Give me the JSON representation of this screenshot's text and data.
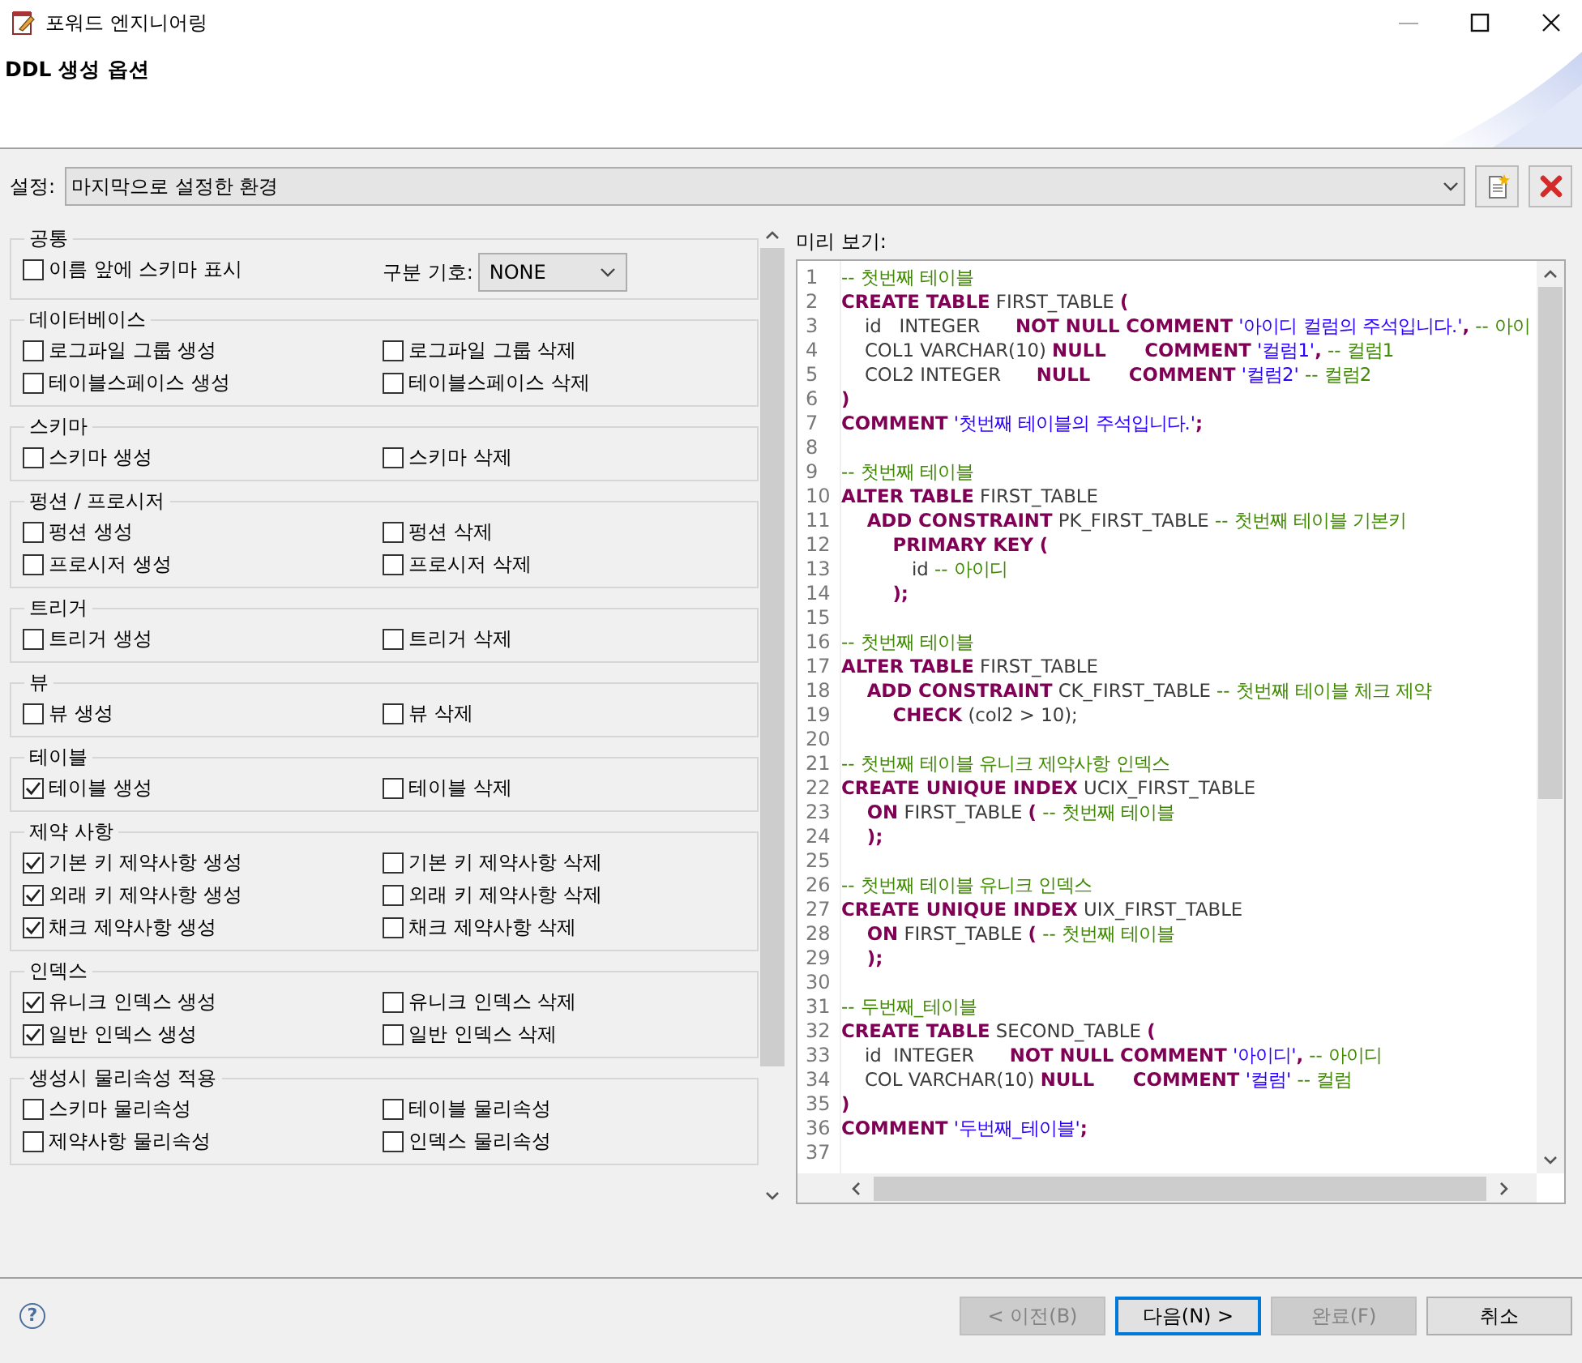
{
  "window": {
    "title": "포워드 엔지니어링"
  },
  "header": {
    "title": "DDL 생성 옵션"
  },
  "settings": {
    "label": "설정:",
    "value": "마지막으로 설정한 환경"
  },
  "options": {
    "groups": [
      {
        "title": "공통",
        "items": [
          {
            "kind": "checkbox",
            "label": "이름 앞에 스키마 표시",
            "checked": false
          },
          {
            "kind": "select",
            "label": "구분 기호:",
            "value": "NONE"
          }
        ]
      },
      {
        "title": "데이터베이스",
        "items": [
          {
            "kind": "checkbox",
            "label": "로그파일 그룹 생성",
            "checked": false
          },
          {
            "kind": "checkbox",
            "label": "로그파일 그룹 삭제",
            "checked": false
          },
          {
            "kind": "checkbox",
            "label": "테이블스페이스 생성",
            "checked": false
          },
          {
            "kind": "checkbox",
            "label": "테이블스페이스 삭제",
            "checked": false
          }
        ]
      },
      {
        "title": "스키마",
        "items": [
          {
            "kind": "checkbox",
            "label": "스키마 생성",
            "checked": false
          },
          {
            "kind": "checkbox",
            "label": "스키마 삭제",
            "checked": false
          }
        ]
      },
      {
        "title": "펑션 / 프로시저",
        "items": [
          {
            "kind": "checkbox",
            "label": "펑션 생성",
            "checked": false
          },
          {
            "kind": "checkbox",
            "label": "펑션 삭제",
            "checked": false
          },
          {
            "kind": "checkbox",
            "label": "프로시저 생성",
            "checked": false
          },
          {
            "kind": "checkbox",
            "label": "프로시저 삭제",
            "checked": false
          }
        ]
      },
      {
        "title": "트리거",
        "items": [
          {
            "kind": "checkbox",
            "label": "트리거 생성",
            "checked": false
          },
          {
            "kind": "checkbox",
            "label": "트리거 삭제",
            "checked": false
          }
        ]
      },
      {
        "title": "뷰",
        "items": [
          {
            "kind": "checkbox",
            "label": "뷰 생성",
            "checked": false
          },
          {
            "kind": "checkbox",
            "label": "뷰 삭제",
            "checked": false
          }
        ]
      },
      {
        "title": "테이블",
        "items": [
          {
            "kind": "checkbox",
            "label": "테이블 생성",
            "checked": true
          },
          {
            "kind": "checkbox",
            "label": "테이블 삭제",
            "checked": false
          }
        ]
      },
      {
        "title": "제약 사항",
        "items": [
          {
            "kind": "checkbox",
            "label": "기본 키 제약사항 생성",
            "checked": true
          },
          {
            "kind": "checkbox",
            "label": "기본 키 제약사항 삭제",
            "checked": false
          },
          {
            "kind": "checkbox",
            "label": "외래 키 제약사항 생성",
            "checked": true
          },
          {
            "kind": "checkbox",
            "label": "외래 키 제약사항 삭제",
            "checked": false
          },
          {
            "kind": "checkbox",
            "label": "채크 제약사항 생성",
            "checked": true
          },
          {
            "kind": "checkbox",
            "label": "채크 제약사항 삭제",
            "checked": false
          }
        ]
      },
      {
        "title": "인덱스",
        "items": [
          {
            "kind": "checkbox",
            "label": "유니크 인덱스 생성",
            "checked": true
          },
          {
            "kind": "checkbox",
            "label": "유니크 인덱스 삭제",
            "checked": false
          },
          {
            "kind": "checkbox",
            "label": "일반 인덱스 생성",
            "checked": true
          },
          {
            "kind": "checkbox",
            "label": "일반 인덱스 삭제",
            "checked": false
          }
        ]
      },
      {
        "title": "생성시 물리속성 적용",
        "items": [
          {
            "kind": "checkbox",
            "label": "스키마 물리속성",
            "checked": false
          },
          {
            "kind": "checkbox",
            "label": "테이블 물리속성",
            "checked": false
          },
          {
            "kind": "checkbox",
            "label": "제약사항 물리속성",
            "checked": false
          },
          {
            "kind": "checkbox",
            "label": "인덱스 물리속성",
            "checked": false
          }
        ]
      }
    ]
  },
  "preview": {
    "label": "미리 보기:",
    "lines": [
      {
        "n": "1",
        "segments": [
          {
            "kind": "comment",
            "s": "-- 첫번째 테이블"
          }
        ]
      },
      {
        "n": "2",
        "segments": [
          {
            "kind": "keyword",
            "s": "CREATE TABLE"
          },
          {
            "kind": "plain",
            "s": " FIRST_TABLE "
          },
          {
            "kind": "keyword",
            "s": "("
          }
        ]
      },
      {
        "n": "3",
        "segments": [
          {
            "kind": "plain",
            "s": "    id   INTEGER      "
          },
          {
            "kind": "keyword",
            "s": "NOT NULL COMMENT"
          },
          {
            "kind": "string",
            "s": " '아이디 컬럼의 주석입니다.'"
          },
          {
            "kind": "keyword",
            "s": ","
          },
          {
            "kind": "comment",
            "s": " -- 아이"
          }
        ]
      },
      {
        "n": "4",
        "segments": [
          {
            "kind": "plain",
            "s": "    COL1 VARCHAR(10) "
          },
          {
            "kind": "keyword",
            "s": "NULL      COMMENT"
          },
          {
            "kind": "string",
            "s": " '컬럼1'"
          },
          {
            "kind": "keyword",
            "s": ","
          },
          {
            "kind": "comment",
            "s": " -- 컬럼1"
          }
        ]
      },
      {
        "n": "5",
        "segments": [
          {
            "kind": "plain",
            "s": "    COL2 INTEGER      "
          },
          {
            "kind": "keyword",
            "s": "NULL      COMMENT"
          },
          {
            "kind": "string",
            "s": " '컬럼2'"
          },
          {
            "kind": "comment",
            "s": " -- 컬럼2"
          }
        ]
      },
      {
        "n": "6",
        "segments": [
          {
            "kind": "keyword",
            "s": ")"
          }
        ]
      },
      {
        "n": "7",
        "segments": [
          {
            "kind": "keyword",
            "s": "COMMENT"
          },
          {
            "kind": "string",
            "s": " '첫번째 테이블의 주석입니다.'"
          },
          {
            "kind": "keyword",
            "s": ";"
          }
        ]
      },
      {
        "n": "8"
      },
      {
        "n": "9",
        "segments": [
          {
            "kind": "comment",
            "s": "-- 첫번째 테이블"
          }
        ]
      },
      {
        "n": "10",
        "segments": [
          {
            "kind": "keyword",
            "s": "ALTER TABLE"
          },
          {
            "kind": "plain",
            "s": " FIRST_TABLE"
          }
        ]
      },
      {
        "n": "11",
        "segments": [
          {
            "kind": "keyword",
            "s": "    ADD CONSTRAINT"
          },
          {
            "kind": "plain",
            "s": " PK_FIRST_TABLE "
          },
          {
            "kind": "comment",
            "s": "-- 첫번째 테이블 기본키"
          }
        ]
      },
      {
        "n": "12",
        "segments": [
          {
            "kind": "keyword",
            "s": "        PRIMARY KEY ("
          }
        ]
      },
      {
        "n": "13",
        "segments": [
          {
            "kind": "plain",
            "s": "            id "
          },
          {
            "kind": "comment",
            "s": "-- 아이디"
          }
        ]
      },
      {
        "n": "14",
        "segments": [
          {
            "kind": "keyword",
            "s": "        );"
          }
        ]
      },
      {
        "n": "15"
      },
      {
        "n": "16",
        "segments": [
          {
            "kind": "comment",
            "s": "-- 첫번째 테이블"
          }
        ]
      },
      {
        "n": "17",
        "segments": [
          {
            "kind": "keyword",
            "s": "ALTER TABLE"
          },
          {
            "kind": "plain",
            "s": " FIRST_TABLE"
          }
        ]
      },
      {
        "n": "18",
        "segments": [
          {
            "kind": "keyword",
            "s": "    ADD CONSTRAINT"
          },
          {
            "kind": "plain",
            "s": " CK_FIRST_TABLE "
          },
          {
            "kind": "comment",
            "s": "-- 첫번째 테이블 체크 제약"
          }
        ]
      },
      {
        "n": "19",
        "segments": [
          {
            "kind": "keyword",
            "s": "        CHECK"
          },
          {
            "kind": "plain",
            "s": " (col2 > 10);"
          }
        ]
      },
      {
        "n": "20"
      },
      {
        "n": "21",
        "segments": [
          {
            "kind": "comment",
            "s": "-- 첫번째 테이블 유니크 제약사항 인덱스"
          }
        ]
      },
      {
        "n": "22",
        "segments": [
          {
            "kind": "keyword",
            "s": "CREATE UNIQUE INDEX"
          },
          {
            "kind": "plain",
            "s": " UCIX_FIRST_TABLE"
          }
        ]
      },
      {
        "n": "23",
        "segments": [
          {
            "kind": "keyword",
            "s": "    ON"
          },
          {
            "kind": "plain",
            "s": " FIRST_TABLE "
          },
          {
            "kind": "keyword",
            "s": "("
          },
          {
            "kind": "comment",
            "s": " -- 첫번째 테이블"
          }
        ]
      },
      {
        "n": "24",
        "segments": [
          {
            "kind": "keyword",
            "s": "    );"
          }
        ]
      },
      {
        "n": "25"
      },
      {
        "n": "26",
        "segments": [
          {
            "kind": "comment",
            "s": "-- 첫번째 테이블 유니크 인덱스"
          }
        ]
      },
      {
        "n": "27",
        "segments": [
          {
            "kind": "keyword",
            "s": "CREATE UNIQUE INDEX"
          },
          {
            "kind": "plain",
            "s": " UIX_FIRST_TABLE"
          }
        ]
      },
      {
        "n": "28",
        "segments": [
          {
            "kind": "keyword",
            "s": "    ON"
          },
          {
            "kind": "plain",
            "s": " FIRST_TABLE "
          },
          {
            "kind": "keyword",
            "s": "("
          },
          {
            "kind": "comment",
            "s": " -- 첫번째 테이블"
          }
        ]
      },
      {
        "n": "29",
        "segments": [
          {
            "kind": "keyword",
            "s": "    );"
          }
        ]
      },
      {
        "n": "30"
      },
      {
        "n": "31",
        "segments": [
          {
            "kind": "comment",
            "s": "-- 두번째_테이블"
          }
        ]
      },
      {
        "n": "32",
        "segments": [
          {
            "kind": "keyword",
            "s": "CREATE TABLE"
          },
          {
            "kind": "plain",
            "s": " SECOND_TABLE "
          },
          {
            "kind": "keyword",
            "s": "("
          }
        ]
      },
      {
        "n": "33",
        "segments": [
          {
            "kind": "plain",
            "s": "    id  INTEGER      "
          },
          {
            "kind": "keyword",
            "s": "NOT NULL COMMENT"
          },
          {
            "kind": "string",
            "s": " '아이디'"
          },
          {
            "kind": "keyword",
            "s": ","
          },
          {
            "kind": "comment",
            "s": " -- 아이디"
          }
        ]
      },
      {
        "n": "34",
        "segments": [
          {
            "kind": "plain",
            "s": "    COL VARCHAR(10) "
          },
          {
            "kind": "keyword",
            "s": "NULL      COMMENT"
          },
          {
            "kind": "string",
            "s": " '컬럼'"
          },
          {
            "kind": "comment",
            "s": " -- 컬럼"
          }
        ]
      },
      {
        "n": "35",
        "segments": [
          {
            "kind": "keyword",
            "s": ")"
          }
        ]
      },
      {
        "n": "36",
        "segments": [
          {
            "kind": "keyword",
            "s": "COMMENT"
          },
          {
            "kind": "string",
            "s": " '두번째_테이블'"
          },
          {
            "kind": "keyword",
            "s": ";"
          }
        ]
      },
      {
        "n": "37"
      }
    ]
  },
  "help": {
    "glyph": "?"
  },
  "buttons": [
    {
      "label": "< 이전(B)",
      "disabled": true,
      "default": false
    },
    {
      "label": "다음(N) >",
      "disabled": false,
      "default": true
    },
    {
      "label": "완료(F)",
      "disabled": true,
      "default": false
    },
    {
      "label": "취소",
      "disabled": false,
      "default": false
    }
  ]
}
